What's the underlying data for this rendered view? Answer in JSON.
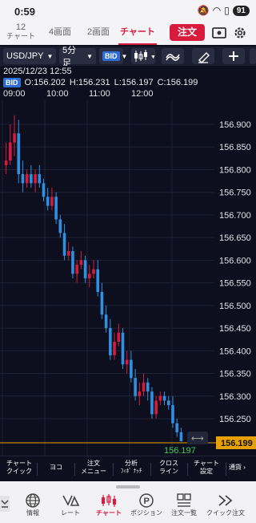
{
  "status": {
    "time": "0:59",
    "battery": "91"
  },
  "tabs": {
    "t12_top": "12",
    "t12_bottom": "チャート",
    "t4": "4画面",
    "t2": "2画面",
    "chart": "チャート",
    "order": "注文"
  },
  "toolbar": {
    "pair": "USD/JPY",
    "interval": "5分足",
    "side": "BID"
  },
  "info": {
    "datetime": "2025/12/23 12:55",
    "side": "BID",
    "open": "O:156.202",
    "high": "H:156.231",
    "low": "L:156.197",
    "close": "C:156.199"
  },
  "time_axis": [
    "09:00",
    "10:00",
    "11:00",
    "12:00"
  ],
  "price_axis": [
    "156.900",
    "156.850",
    "156.800",
    "156.750",
    "156.700",
    "156.650",
    "156.600",
    "156.550",
    "156.500",
    "156.450",
    "156.400",
    "156.350",
    "156.300",
    "156.250"
  ],
  "current_price": "156.199",
  "low_marker": "156.197",
  "colors": {
    "up": "#d81b3c",
    "down": "#2f8fe0",
    "price_line": "#e8a000",
    "accent": "#d81b3c"
  },
  "chart_data": {
    "type": "candlestick",
    "symbol": "USD/JPY",
    "interval": "5分足",
    "ylim": [
      156.2,
      156.93
    ],
    "candles": [
      [
        156.81,
        156.86,
        156.79,
        156.82
      ],
      [
        156.82,
        156.9,
        156.81,
        156.86
      ],
      [
        156.86,
        156.92,
        156.83,
        156.88
      ],
      [
        156.88,
        156.91,
        156.77,
        156.79
      ],
      [
        156.79,
        156.82,
        156.75,
        156.77
      ],
      [
        156.77,
        156.8,
        156.76,
        156.79
      ],
      [
        156.79,
        156.81,
        156.76,
        156.77
      ],
      [
        156.77,
        156.8,
        156.75,
        156.79
      ],
      [
        156.79,
        156.81,
        156.76,
        156.77
      ],
      [
        156.77,
        156.78,
        156.73,
        156.74
      ],
      [
        156.74,
        156.76,
        156.71,
        156.72
      ],
      [
        156.72,
        156.76,
        156.71,
        156.74
      ],
      [
        156.74,
        156.75,
        156.68,
        156.69
      ],
      [
        156.69,
        156.7,
        156.65,
        156.66
      ],
      [
        156.66,
        156.68,
        156.6,
        156.61
      ],
      [
        156.61,
        156.64,
        156.6,
        156.62
      ],
      [
        156.62,
        156.63,
        156.56,
        156.57
      ],
      [
        156.57,
        156.6,
        156.55,
        156.59
      ],
      [
        156.59,
        156.62,
        156.58,
        156.6
      ],
      [
        156.6,
        156.61,
        156.55,
        156.56
      ],
      [
        156.56,
        156.59,
        156.54,
        156.57
      ],
      [
        156.57,
        156.6,
        156.56,
        156.58
      ],
      [
        156.58,
        156.6,
        156.52,
        156.53
      ],
      [
        156.53,
        156.55,
        156.47,
        156.48
      ],
      [
        156.48,
        156.5,
        156.44,
        156.45
      ],
      [
        156.45,
        156.47,
        156.38,
        156.39
      ],
      [
        156.39,
        156.44,
        156.38,
        156.42
      ],
      [
        156.42,
        156.46,
        156.41,
        156.44
      ],
      [
        156.44,
        156.45,
        156.36,
        156.37
      ],
      [
        156.37,
        156.4,
        156.35,
        156.38
      ],
      [
        156.38,
        156.4,
        156.33,
        156.34
      ],
      [
        156.34,
        156.36,
        156.29,
        156.3
      ],
      [
        156.3,
        156.33,
        156.28,
        156.31
      ],
      [
        156.31,
        156.35,
        156.3,
        156.33
      ],
      [
        156.33,
        156.34,
        156.29,
        156.31
      ],
      [
        156.31,
        156.32,
        156.25,
        156.26
      ],
      [
        156.26,
        156.3,
        156.25,
        156.29
      ],
      [
        156.29,
        156.31,
        156.28,
        156.3
      ],
      [
        156.3,
        156.31,
        156.28,
        156.29
      ],
      [
        156.29,
        156.3,
        156.27,
        156.28
      ],
      [
        156.28,
        156.3,
        156.23,
        156.24
      ],
      [
        156.24,
        156.25,
        156.21,
        156.22
      ],
      [
        156.22,
        156.23,
        156.2,
        156.2
      ]
    ]
  },
  "menu": [
    {
      "l1": "チャート",
      "l2": "クイック"
    },
    {
      "l1": "ヨコ",
      "l2": ""
    },
    {
      "l1": "注文",
      "l2": "メニュー"
    },
    {
      "l1": "分析",
      "l2": "ﾌｨﾎﾞ ﾅｯﾁ"
    },
    {
      "l1": "クロス",
      "l2": "ライン"
    },
    {
      "l1": "チャート",
      "l2": "設定"
    },
    {
      "l1": "通貨",
      "l2": ""
    }
  ],
  "nav": [
    {
      "label": "情報",
      "icon": "globe-icon"
    },
    {
      "label": "レート",
      "icon": "rate-icon"
    },
    {
      "label": "チャート",
      "icon": "chart-icon"
    },
    {
      "label": "ポジション",
      "icon": "position-icon"
    },
    {
      "label": "注文一覧",
      "icon": "order-list-icon"
    },
    {
      "label": "クイック注文",
      "icon": "quick-order-icon"
    }
  ]
}
